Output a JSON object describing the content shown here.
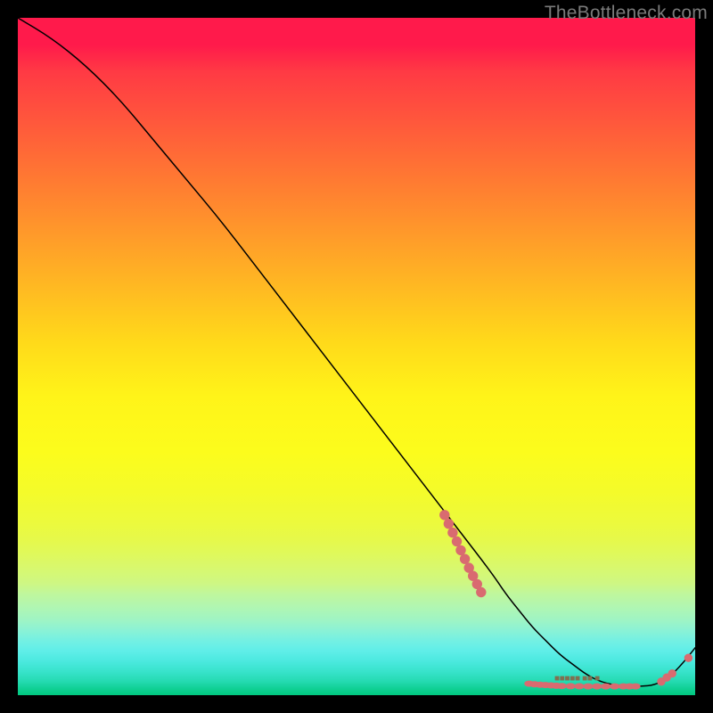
{
  "watermark": "TheBottleneck.com",
  "chart_data": {
    "type": "line",
    "title": "",
    "xlabel": "",
    "ylabel": "",
    "xlim": [
      0,
      100
    ],
    "ylim": [
      0,
      100
    ],
    "curve": {
      "x": [
        0,
        5,
        10,
        15,
        20,
        25,
        30,
        35,
        40,
        45,
        50,
        55,
        60,
        65,
        70,
        72,
        74,
        76,
        78,
        80,
        82,
        84,
        86,
        88,
        90,
        92,
        94,
        96,
        98,
        100
      ],
      "y": [
        100,
        97,
        93,
        88,
        82,
        76,
        70,
        63.5,
        57,
        50.5,
        44,
        37.5,
        31,
        24.5,
        18,
        15,
        12.5,
        10,
        8,
        6,
        4.5,
        3,
        2,
        1.5,
        1.3,
        1.3,
        1.5,
        2.5,
        4.5,
        7
      ]
    },
    "cluster_a": {
      "comment": "dense dot cluster along the descending slope",
      "x": [
        63.0,
        63.6,
        64.2,
        64.8,
        65.4,
        66.0,
        66.6,
        67.2,
        67.8,
        68.4
      ],
      "y": [
        26.6,
        25.3,
        24.0,
        22.7,
        21.4,
        20.1,
        18.8,
        17.6,
        16.4,
        15.2
      ]
    },
    "cluster_b": {
      "comment": "dot cluster along the flat bottom",
      "x": [
        75.5,
        76.3,
        77.1,
        77.9,
        78.7,
        79.5,
        80.3,
        81.6,
        82.9,
        84.2,
        85.5,
        86.8,
        88.1,
        89.4,
        90.3,
        91.2
      ],
      "y": [
        1.7,
        1.6,
        1.55,
        1.5,
        1.45,
        1.4,
        1.35,
        1.33,
        1.31,
        1.3,
        1.3,
        1.3,
        1.3,
        1.3,
        1.3,
        1.3
      ]
    },
    "cluster_c": {
      "comment": "dot cluster on right upturn",
      "x": [
        95.0,
        95.8,
        96.6,
        99.0
      ],
      "y": [
        2.0,
        2.6,
        3.2,
        5.5
      ]
    },
    "bottom_label": "■■■■■ ■■ ■"
  }
}
